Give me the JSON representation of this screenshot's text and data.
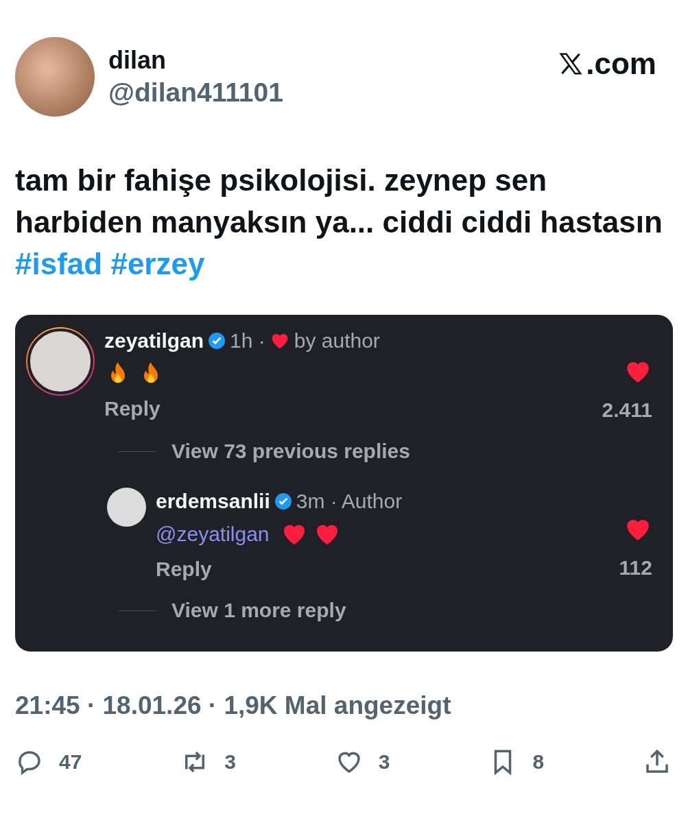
{
  "author": {
    "name": "dilan",
    "handle": "@dilan411101",
    "site": ".com"
  },
  "post": {
    "text": "tam bir fahişe psikolojisi. zeynep sen harbiden manyaksın ya... ciddi ciddi hastasın",
    "hashtags": [
      "#isfad",
      "#erzey"
    ]
  },
  "embed": {
    "comments": [
      {
        "kind": "comment",
        "user": "zeyatilgan",
        "verified": true,
        "story_ring": true,
        "time": "1h ·",
        "label_heart": true,
        "label": "by author",
        "emoji": [
          {
            "kind": "fire"
          },
          {
            "kind": "fire"
          }
        ],
        "reply": "Reply",
        "liked": true,
        "likes": "2.411",
        "children": [
          {
            "kind": "more",
            "text": "View 73 previous replies"
          },
          {
            "kind": "comment",
            "user": "erdemsanlii",
            "verified": true,
            "story_ring": false,
            "time": "3m ·",
            "label_heart": false,
            "label": "Author",
            "mention": "@zeyatilgan",
            "emoji": [
              {
                "kind": "heart"
              },
              {
                "kind": "heart"
              }
            ],
            "reply": "Reply",
            "liked": true,
            "likes": "112"
          },
          {
            "kind": "more",
            "text": "View 1 more reply"
          }
        ]
      }
    ]
  },
  "meta": "21:45 · 18.01.26 · **1,9K** Mal angezeigt",
  "actions": [
    {
      "kind": "reply",
      "count": "47"
    },
    {
      "kind": "repost",
      "count": "3"
    },
    {
      "kind": "like",
      "count": "3"
    },
    {
      "kind": "bookmark",
      "count": "8"
    },
    {
      "kind": "share"
    }
  ]
}
